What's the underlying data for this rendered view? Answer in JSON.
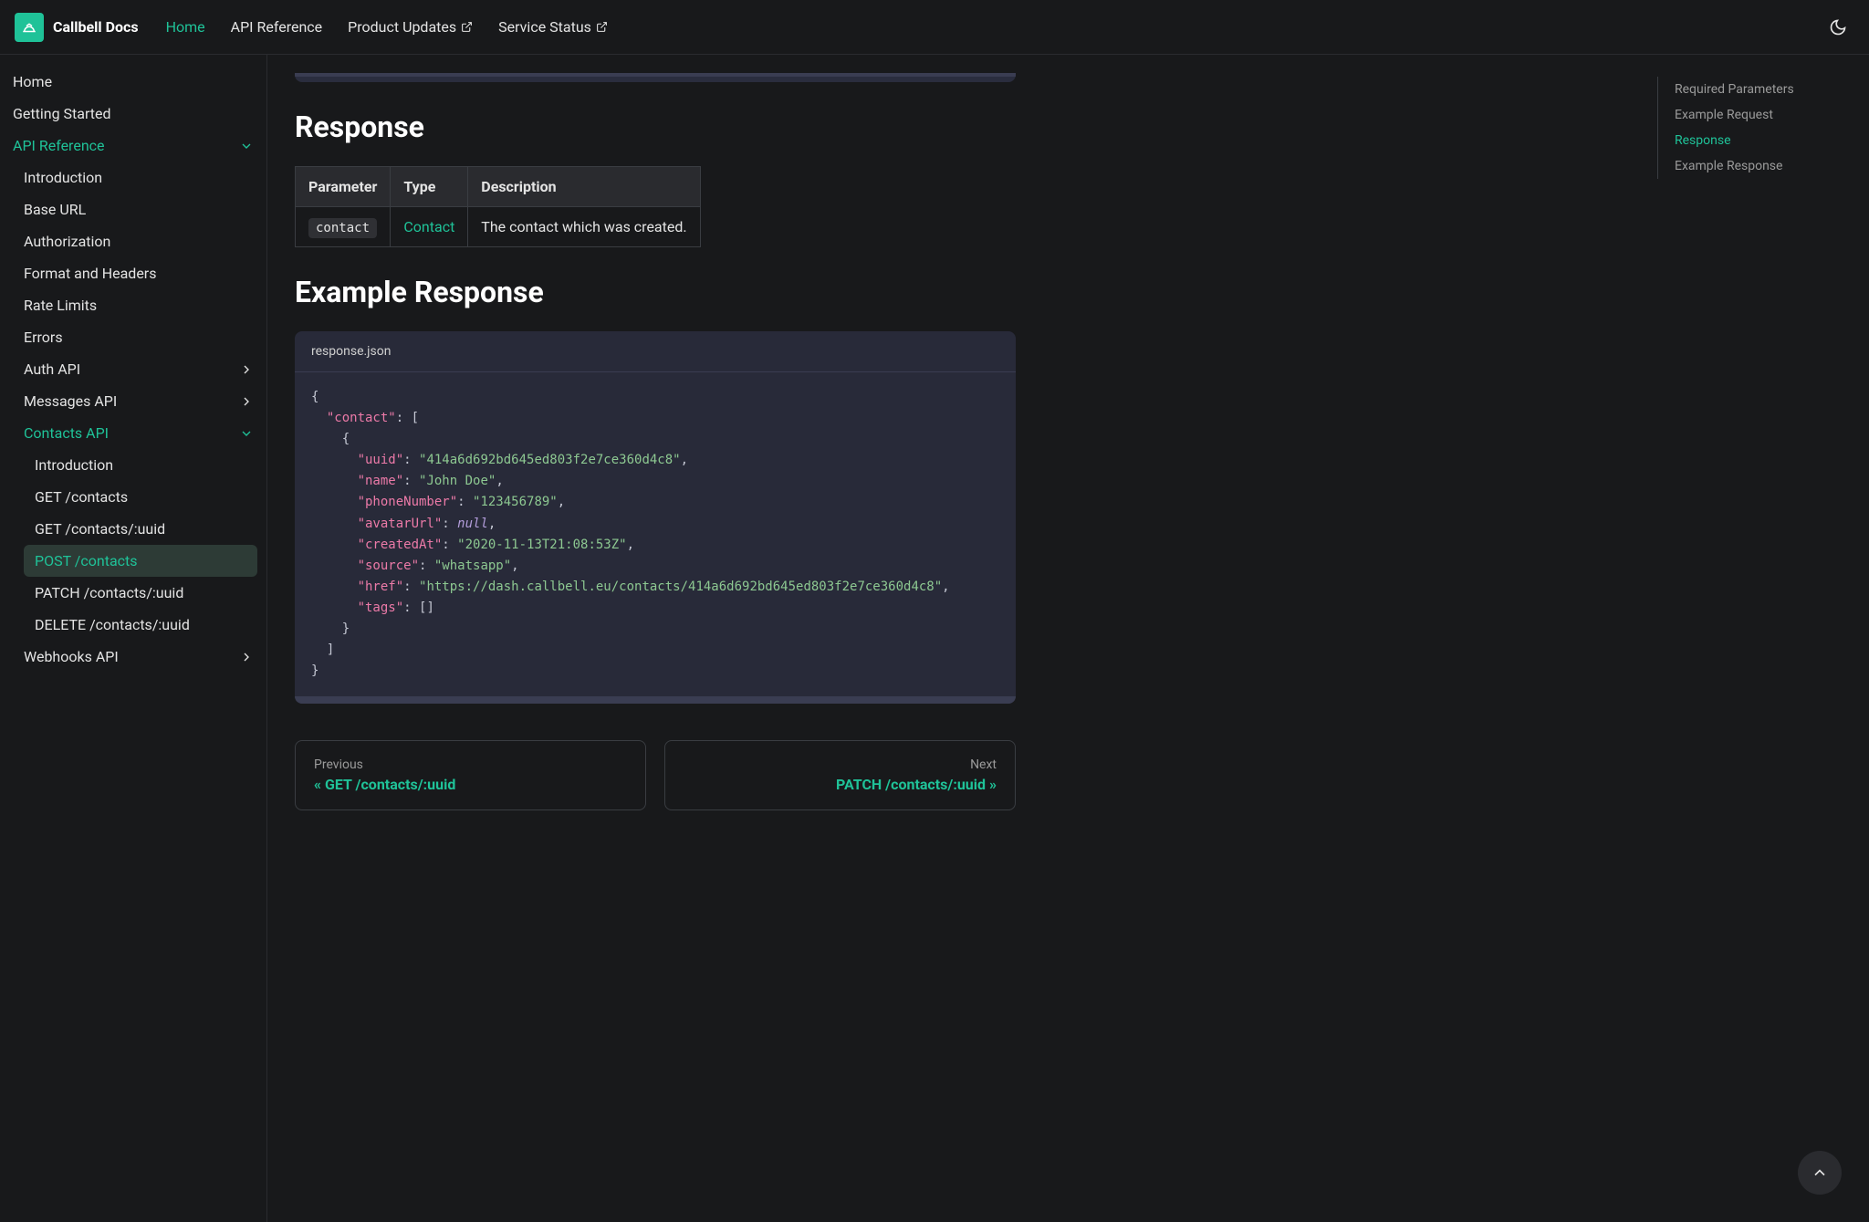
{
  "brand": "Callbell Docs",
  "nav": {
    "home": "Home",
    "api_ref": "API Reference",
    "product_updates": "Product Updates",
    "service_status": "Service Status"
  },
  "sidebar": {
    "home": "Home",
    "getting_started": "Getting Started",
    "api_reference": "API Reference",
    "introduction": "Introduction",
    "base_url": "Base URL",
    "authorization": "Authorization",
    "format_headers": "Format and Headers",
    "rate_limits": "Rate Limits",
    "errors": "Errors",
    "auth_api": "Auth API",
    "messages_api": "Messages API",
    "contacts_api": "Contacts API",
    "c_intro": "Introduction",
    "c_get": "GET /contacts",
    "c_get_uuid": "GET /contacts/:uuid",
    "c_post": "POST /contacts",
    "c_patch": "PATCH /contacts/:uuid",
    "c_delete": "DELETE /contacts/:uuid",
    "webhooks": "Webhooks API"
  },
  "headings": {
    "response": "Response",
    "example_response": "Example Response"
  },
  "table": {
    "h_param": "Parameter",
    "h_type": "Type",
    "h_desc": "Description",
    "r_param": "contact",
    "r_type": "Contact",
    "r_desc": "The contact which was created."
  },
  "code": {
    "filename": "response.json",
    "k_contact": "\"contact\"",
    "k_uuid": "\"uuid\"",
    "k_name": "\"name\"",
    "k_phone": "\"phoneNumber\"",
    "k_avatar": "\"avatarUrl\"",
    "k_created": "\"createdAt\"",
    "k_source": "\"source\"",
    "k_href": "\"href\"",
    "k_tags": "\"tags\"",
    "v_uuid": "\"414a6d692bd645ed803f2e7ce360d4c8\"",
    "v_name": "\"John Doe\"",
    "v_phone": "\"123456789\"",
    "v_null": "null",
    "v_created": "\"2020-11-13T21:08:53Z\"",
    "v_source": "\"whatsapp\"",
    "v_href": "\"https://dash.callbell.eu/contacts/414a6d692bd645ed803f2e7ce360d4c8\""
  },
  "pager": {
    "prev_label": "Previous",
    "prev_title": "« GET /contacts/:uuid",
    "next_label": "Next",
    "next_title": "PATCH /contacts/:uuid »"
  },
  "toc": {
    "required_params": "Required Parameters",
    "example_request": "Example Request",
    "response": "Response",
    "example_response": "Example Response"
  }
}
